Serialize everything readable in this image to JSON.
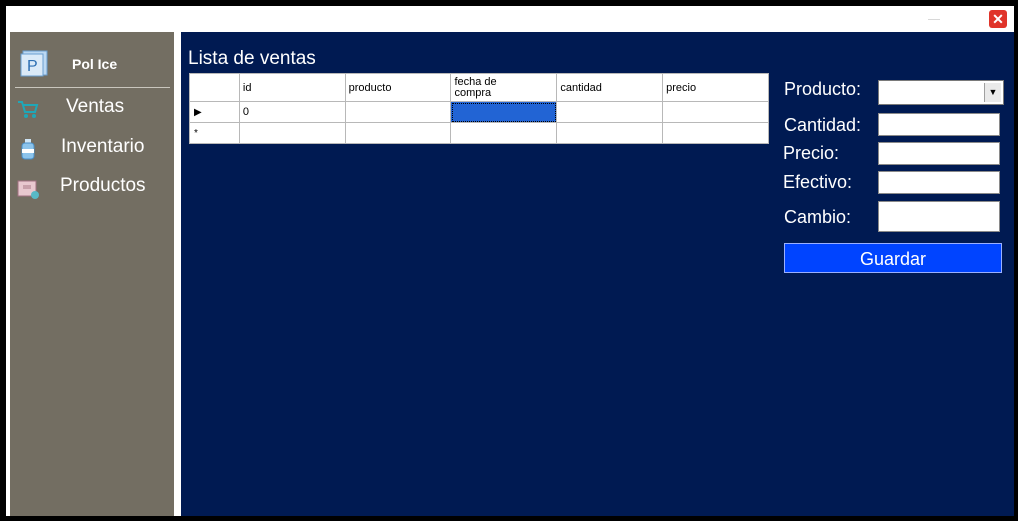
{
  "window": {
    "close_glyph": "✕"
  },
  "sidebar": {
    "brand": "Pol Ice",
    "logo_letter": "P",
    "items": [
      {
        "label": "Ventas",
        "icon": "cart-icon"
      },
      {
        "label": "Inventario",
        "icon": "bottle-icon"
      },
      {
        "label": "Productos",
        "icon": "box-icon"
      }
    ]
  },
  "main": {
    "title": "Lista de ventas",
    "table": {
      "columns": [
        "id",
        "producto",
        "fecha de compra",
        "cantidad",
        "precio"
      ],
      "rows": [
        {
          "marker": "▶",
          "cells": [
            "0",
            "",
            "",
            "",
            ""
          ]
        },
        {
          "marker": "*",
          "cells": [
            "",
            "",
            "",
            "",
            ""
          ]
        }
      ]
    }
  },
  "form": {
    "producto_label": "Producto:",
    "cantidad_label": "Cantidad:",
    "precio_label": "Precio:",
    "efectivo_label": "Efectivo:",
    "cambio_label": "Cambio:",
    "producto_value": "",
    "save_label": "Guardar"
  },
  "colors": {
    "main_bg": "#001a52",
    "sidebar_bg": "#736e62",
    "button_bg": "#0044ff",
    "close_bg": "#e0342a"
  }
}
